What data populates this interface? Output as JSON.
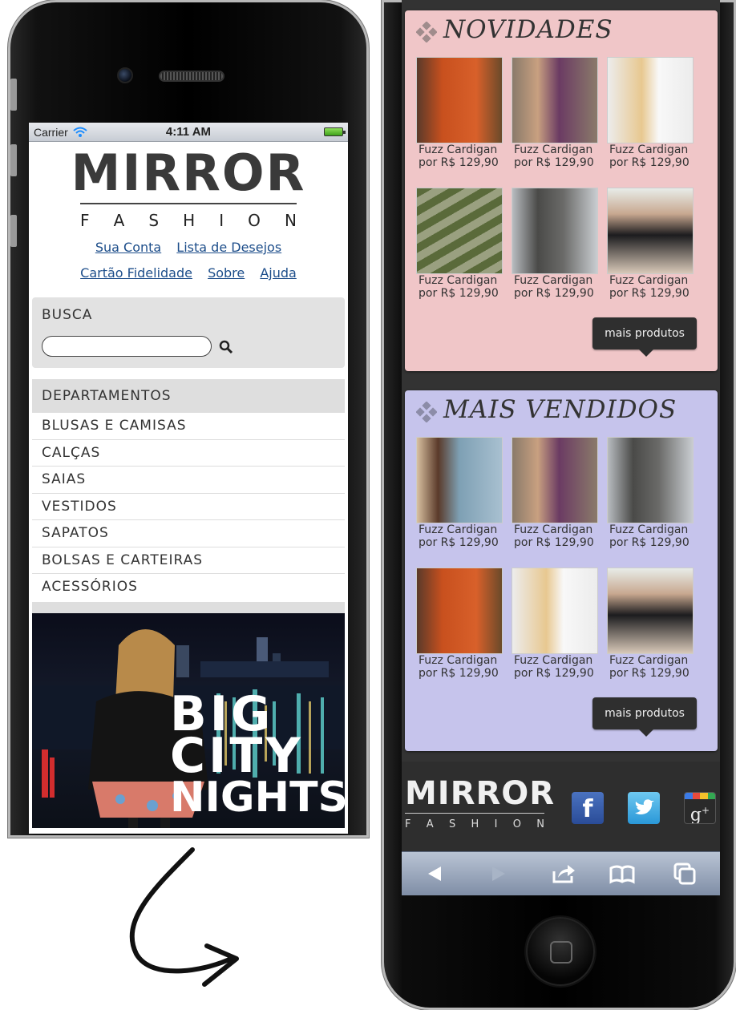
{
  "status_bar": {
    "carrier": "Carrier",
    "time": "4:11 AM"
  },
  "logo": {
    "mirror": "MIRROR",
    "fashion": "F A S H I O N"
  },
  "top_links": [
    "Sua Conta",
    "Lista de Desejos",
    "Cartão Fidelidade",
    "Sobre",
    "Ajuda"
  ],
  "search": {
    "title": "BUSCA",
    "placeholder": ""
  },
  "departments": {
    "title": "DEPARTAMENTOS",
    "items": [
      "BLUSAS E CAMISAS",
      "CALÇAS",
      "SAIAS",
      "VESTIDOS",
      "SAPATOS",
      "BOLSAS E CARTEIRAS",
      "ACESSÓRIOS"
    ]
  },
  "banner": {
    "line1": "BIG",
    "line2": "CITY",
    "line3": "NIGHTS"
  },
  "novidades": {
    "title": "NOVIDADES",
    "more_button": "mais produtos",
    "products": [
      {
        "name": "Fuzz Cardigan",
        "price": "por R$ 129,90",
        "color": "#c8501e"
      },
      {
        "name": "Fuzz Cardigan",
        "price": "por R$ 129,90",
        "color": "#6b3b63"
      },
      {
        "name": "Fuzz Cardigan",
        "price": "por R$ 129,90",
        "color": "#f4f4f4"
      },
      {
        "name": "Fuzz Cardigan",
        "price": "por R$ 129,90",
        "color": "#e8c830"
      },
      {
        "name": "Fuzz Cardigan",
        "price": "por R$ 129,90",
        "color": "#4a4a48"
      },
      {
        "name": "Fuzz Cardigan",
        "price": "por R$ 129,90",
        "color": "#1c1c1e"
      }
    ]
  },
  "mais_vendidos": {
    "title": "MAIS VENDIDOS",
    "more_button": "mais produtos",
    "products": [
      {
        "name": "Fuzz Cardigan",
        "price": "por R$ 129,90",
        "color": "#7ea0b4"
      },
      {
        "name": "Fuzz Cardigan",
        "price": "por R$ 129,90",
        "color": "#6b3b63"
      },
      {
        "name": "Fuzz Cardigan",
        "price": "por R$ 129,90",
        "color": "#4a4a48"
      },
      {
        "name": "Fuzz Cardigan",
        "price": "por R$ 129,90",
        "color": "#c8501e"
      },
      {
        "name": "Fuzz Cardigan",
        "price": "por R$ 129,90",
        "color": "#f4f4f4"
      },
      {
        "name": "Fuzz Cardigan",
        "price": "por R$ 129,90",
        "color": "#1c1c1e"
      }
    ]
  },
  "footer": {
    "mirror": "MIRROR",
    "fashion": "F A S H I O N",
    "social": [
      "f",
      "twitter",
      "g+"
    ]
  },
  "colors": {
    "novidades_bg": "#f0c6c8",
    "mais_vendidos_bg": "#c6c4ec",
    "link": "#1c4d8a"
  }
}
